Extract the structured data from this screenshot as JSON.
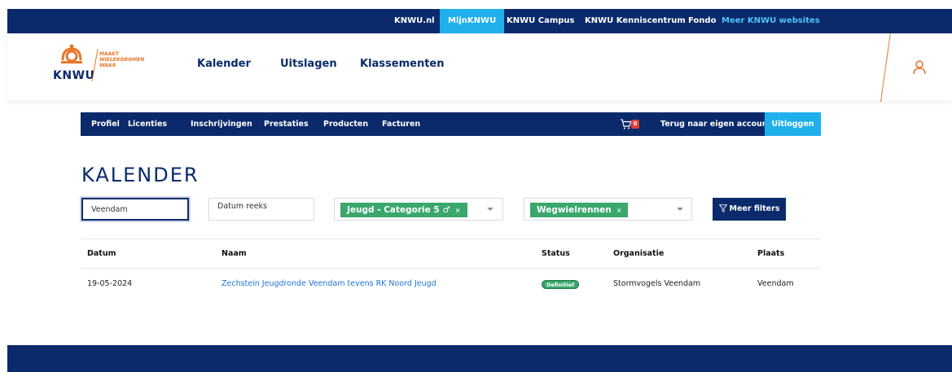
{
  "topbar": {
    "links": [
      {
        "label": "KNWU.nl",
        "active": false
      },
      {
        "label": "MijnKNWU",
        "active": true
      },
      {
        "label": "KNWU Campus",
        "active": false
      },
      {
        "label": "KNWU Kenniscentrum",
        "active": false
      },
      {
        "label": "Fondo",
        "active": false
      },
      {
        "label": "Meer KNWU websites",
        "active": false
      }
    ]
  },
  "header": {
    "logo": {
      "word": "KNWU",
      "slogan_1": "MAAKT",
      "slogan_2": "WIELERDROMEN",
      "slogan_3": "WAAR"
    },
    "nav": [
      "Kalender",
      "Uitslagen",
      "Klassementen"
    ],
    "user_icon": "user-icon"
  },
  "subnav": {
    "items": [
      "Profiel",
      "Licenties",
      "Inschrijvingen",
      "Prestaties",
      "Producten",
      "Facturen"
    ],
    "cart_count": "0",
    "back_label": "Terug naar eigen account",
    "logout_label": "Uitloggen"
  },
  "page": {
    "title": "KALENDER"
  },
  "filters": {
    "search_value": "Veendam",
    "date_placeholder": "Datum reeks",
    "category_chip": "Jeugd - Categorie 5 ♂",
    "discipline_chip": "Wegwielrennen",
    "chip_remove": "×",
    "more_label": "Meer filters"
  },
  "table": {
    "columns": [
      "Datum",
      "Naam",
      "Status",
      "Organisatie",
      "Plaats"
    ],
    "rows": [
      {
        "date": "19-05-2024",
        "name": "Zechstein Jeugdronde Veendam tevens RK Noord Jeugd",
        "status": "Definitief",
        "organisation": "Stormvogels Veendam",
        "place": "Veendam"
      }
    ]
  },
  "colors": {
    "navy": "#0a2a6b",
    "cyan": "#1fb0ec",
    "orange": "#e8762b",
    "green": "#3aa76d",
    "link": "#1f74d6"
  }
}
